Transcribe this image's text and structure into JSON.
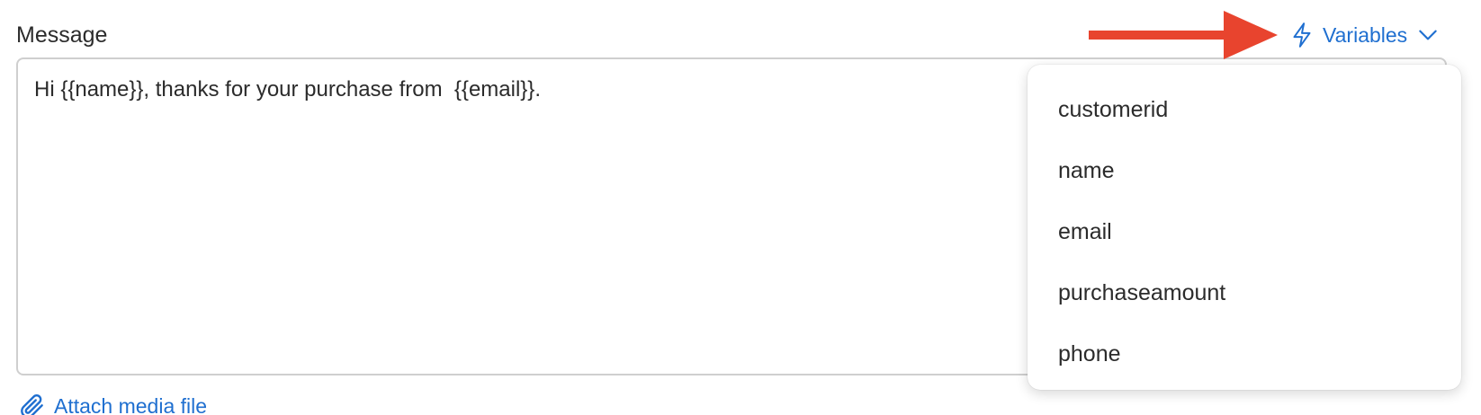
{
  "field": {
    "label": "Message",
    "value": "Hi {{name}}, thanks for your purchase from  {{email}}."
  },
  "attach": {
    "label": "Attach media file",
    "icon": "paperclip-icon"
  },
  "variables": {
    "label": "Variables",
    "icon": "lightning-icon",
    "chevron_icon": "chevron-down-icon",
    "items": [
      {
        "label": "customerid"
      },
      {
        "label": "name"
      },
      {
        "label": "email"
      },
      {
        "label": "purchaseamount"
      },
      {
        "label": "phone"
      }
    ]
  },
  "annotation": {
    "icon": "arrow-right-icon",
    "color": "#e8442e"
  },
  "colors": {
    "accent": "#1f6fd0",
    "text": "#2b2b2b",
    "border": "#cfcfcf"
  }
}
